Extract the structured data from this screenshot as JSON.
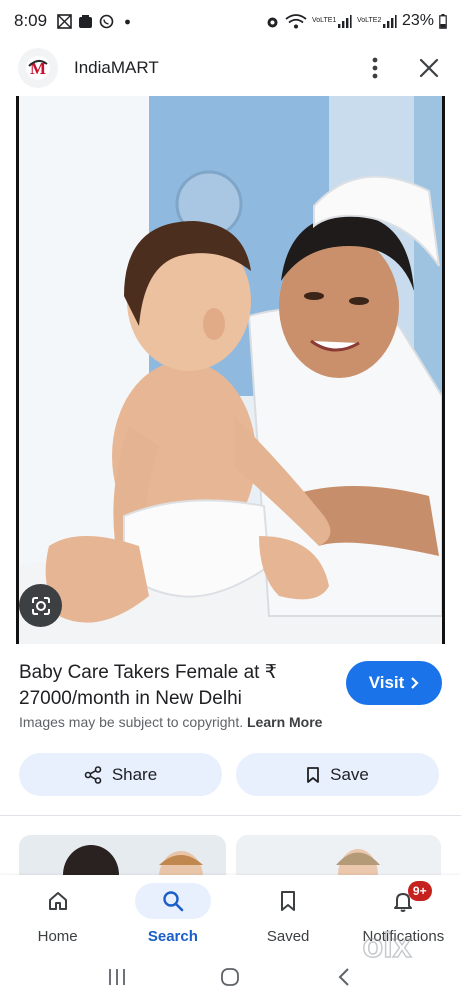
{
  "status_bar": {
    "time": "8:09",
    "battery": "23%",
    "net1": "VoLTE1",
    "net2": "VoLTE2"
  },
  "app_bar": {
    "title": "IndiaMART",
    "logo_text": "M"
  },
  "result": {
    "title": "Baby Care Takers Female at ₹ 27000/month in New Delhi",
    "copyright_text": "Images may be subject to copyright.",
    "learn_more": "Learn More",
    "visit_label": "Visit",
    "share_label": "Share",
    "save_label": "Save"
  },
  "bottom_nav": {
    "items": [
      {
        "label": "Home",
        "icon": "home-icon"
      },
      {
        "label": "Search",
        "icon": "search-icon",
        "active": true
      },
      {
        "label": "Saved",
        "icon": "saved-icon"
      },
      {
        "label": "Notifications",
        "icon": "bell-icon",
        "badge": "9+"
      }
    ]
  },
  "watermark": "olx",
  "colors": {
    "accent": "#1a73e8",
    "tonal": "#e8f0fe",
    "badge": "#c5221f"
  }
}
